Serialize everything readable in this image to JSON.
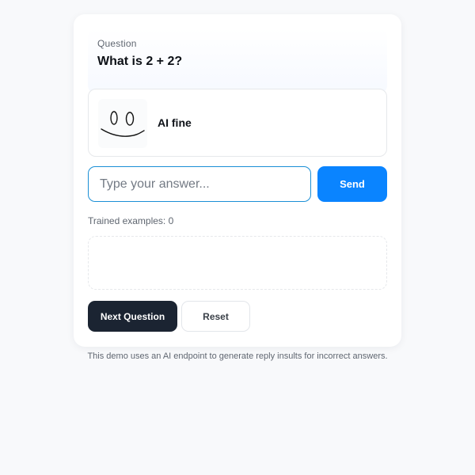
{
  "question": {
    "label": "Question",
    "text": "What is 2 + 2?"
  },
  "ai": {
    "avatar_icon": "smiley-face-icon",
    "status": "AI fine"
  },
  "answer": {
    "value": "",
    "placeholder": "Type your answer..."
  },
  "actions": {
    "send_label": "Send",
    "next_label": "Next Question",
    "reset_label": "Reset"
  },
  "trained": {
    "text": "Trained examples: 0"
  },
  "footer": {
    "note": "This demo uses an AI endpoint to generate reply insults for incorrect answers."
  },
  "colors": {
    "accent": "#0a84ff",
    "input_border": "#1a8fd6",
    "dark_button": "#1b2432"
  }
}
